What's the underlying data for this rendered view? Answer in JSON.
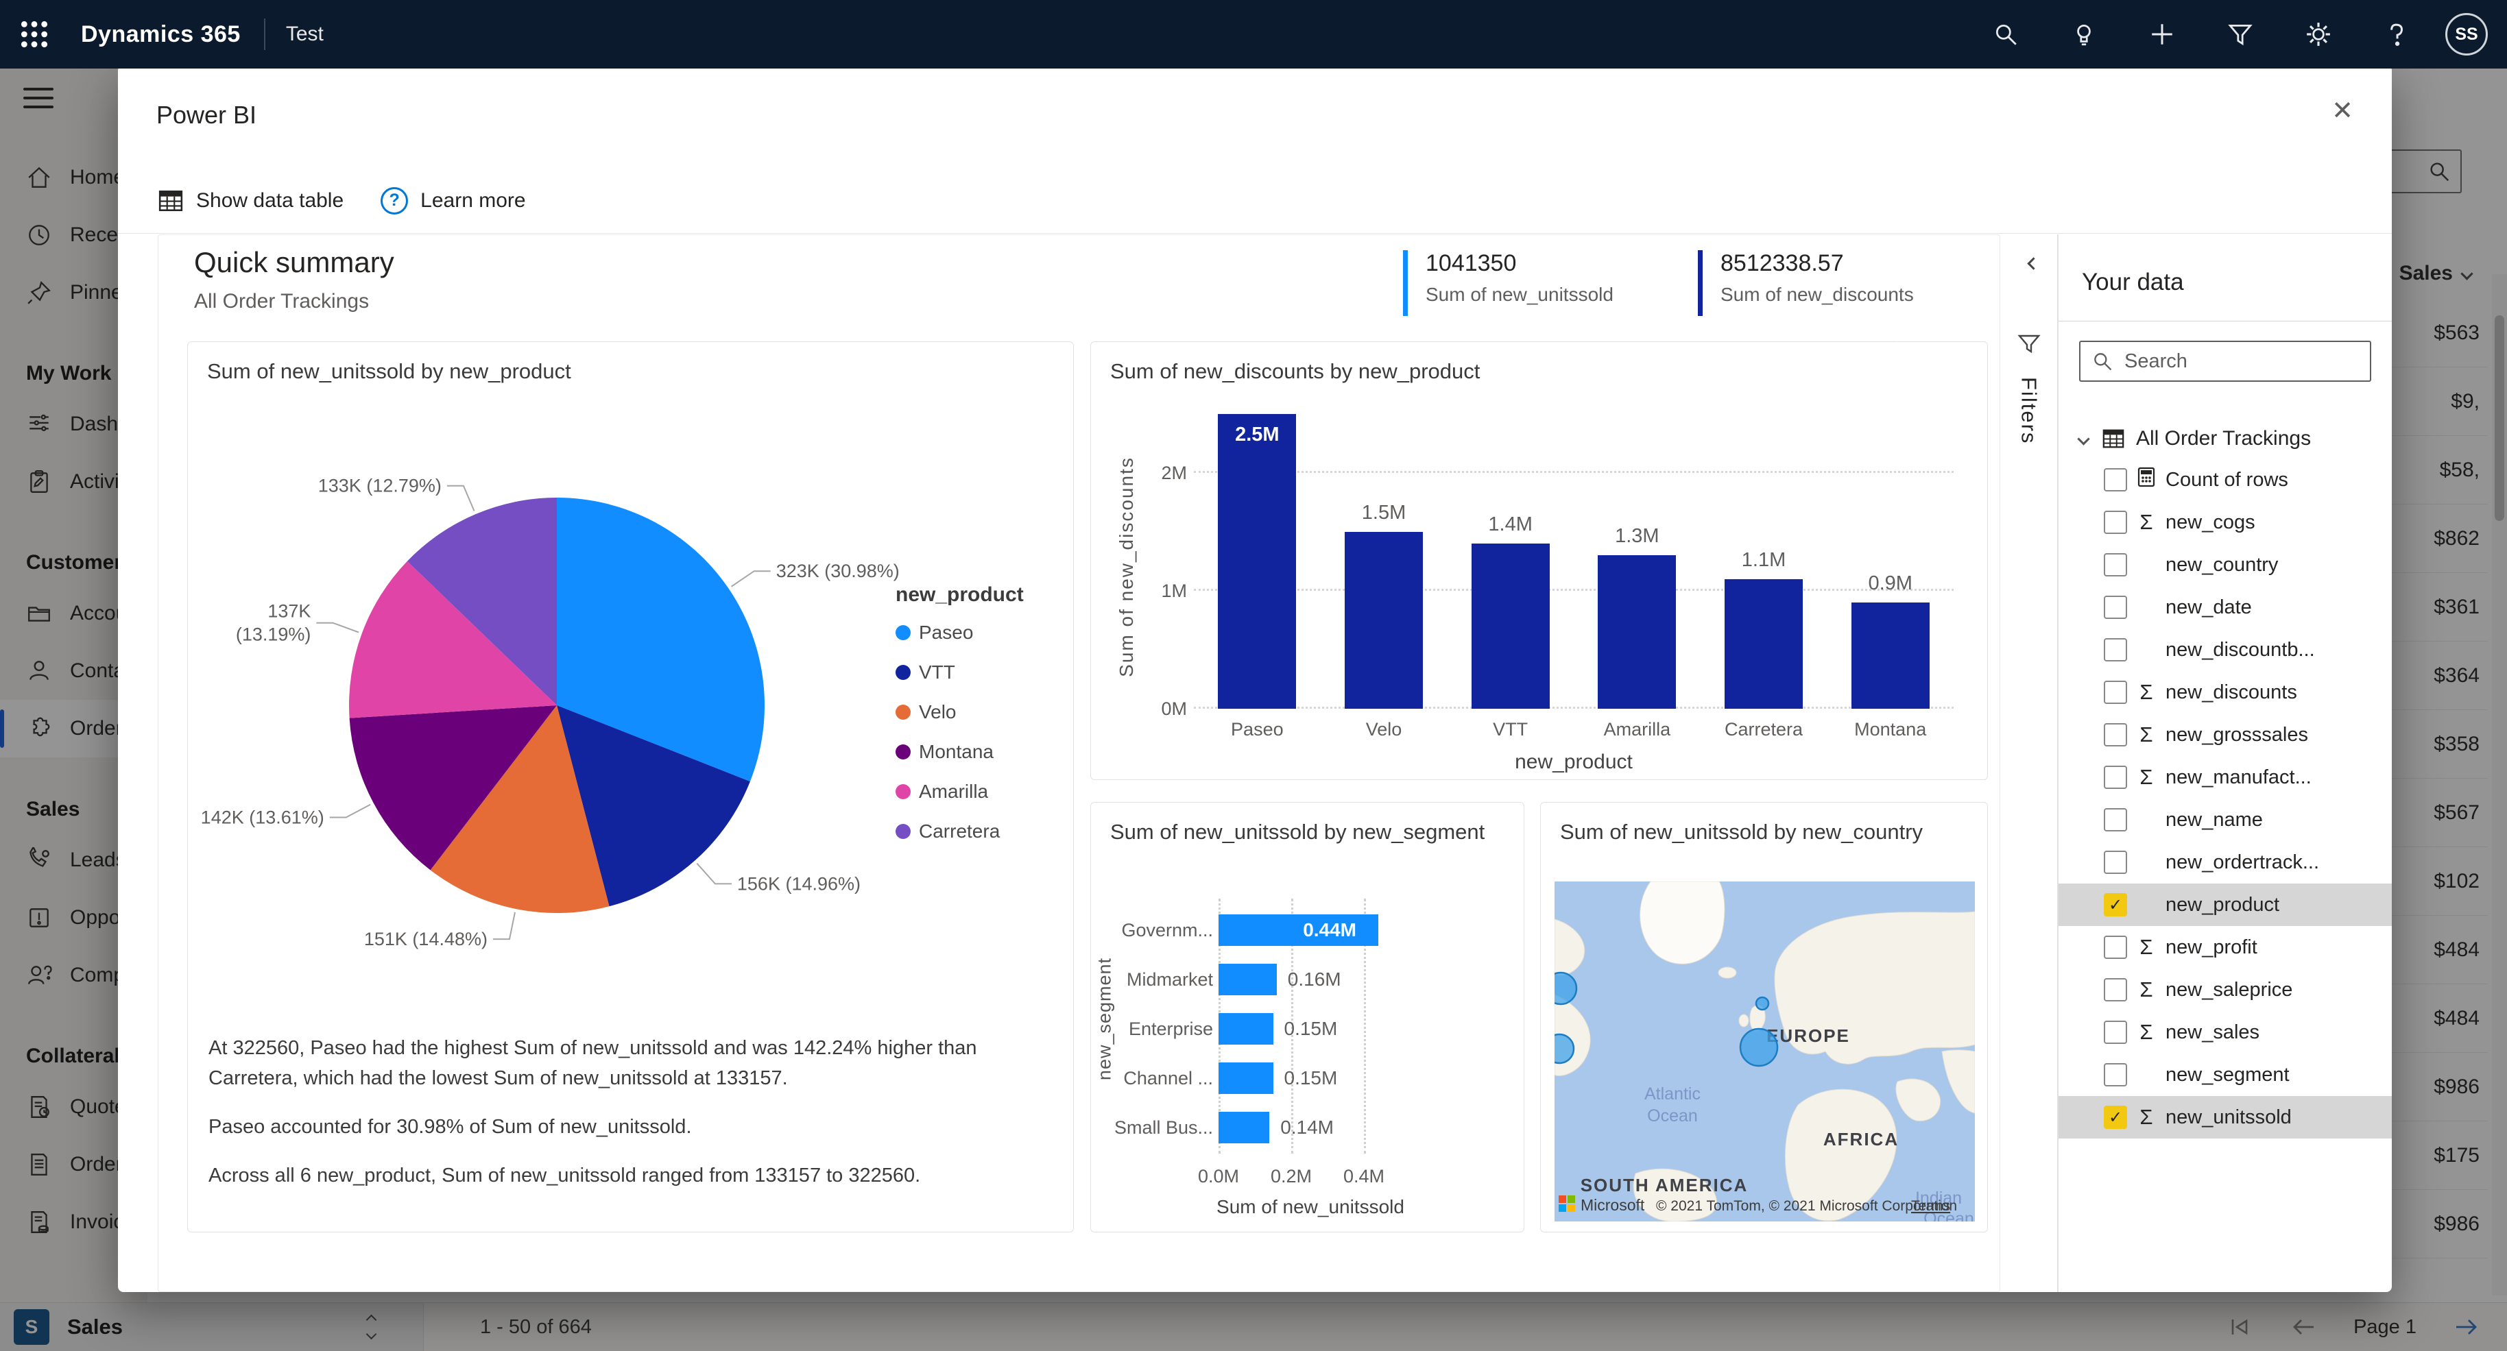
{
  "glyphs": {
    "close": "✕",
    "check": "✓",
    "sigma": "Σ",
    "ellipsis": "…",
    "pencil": "✎"
  },
  "colors": {
    "topbar": "#0b1a2c",
    "nav_selected_accent": "#2266E3",
    "checkbox_checked": "#F2C811",
    "metric1_accent": "#118DFF",
    "metric2_accent": "#12239E"
  },
  "topbar": {
    "app_title": "Dynamics 365",
    "environment": "Test",
    "avatar_initials": "SS"
  },
  "sidebar": {
    "entries": [
      {
        "type": "item",
        "icon": "home",
        "label": "Home"
      },
      {
        "type": "item",
        "icon": "clock",
        "label": "Recent"
      },
      {
        "type": "item",
        "icon": "pin",
        "label": "Pinned"
      },
      {
        "type": "header",
        "label": "My Work"
      },
      {
        "type": "item",
        "icon": "dashboard",
        "label": "Dashboards"
      },
      {
        "type": "item",
        "icon": "clipboard",
        "label": "Activities"
      },
      {
        "type": "header",
        "label": "Customers"
      },
      {
        "type": "item",
        "icon": "folder",
        "label": "Accounts"
      },
      {
        "type": "item",
        "icon": "person",
        "label": "Contacts"
      },
      {
        "type": "item",
        "icon": "puzzle",
        "label": "Orders",
        "selected": true
      },
      {
        "type": "header",
        "label": "Sales"
      },
      {
        "type": "item",
        "icon": "phone",
        "label": "Leads"
      },
      {
        "type": "item",
        "icon": "alert-box",
        "label": "Opportunities"
      },
      {
        "type": "item",
        "icon": "person-question",
        "label": "Competitors"
      },
      {
        "type": "header",
        "label": "Collateral"
      },
      {
        "type": "item",
        "icon": "doc-clock",
        "label": "Quotes"
      },
      {
        "type": "item",
        "icon": "doc",
        "label": "Orders"
      },
      {
        "type": "item",
        "icon": "doc-coins",
        "label": "Invoices"
      }
    ],
    "area_switcher": {
      "initial": "S",
      "label": "Sales"
    }
  },
  "background_grid": {
    "column_header": "Sales",
    "row_values": [
      "$563",
      "$9,",
      "$58,",
      "$862",
      "$361",
      "$364",
      "$358",
      "$567",
      "$102",
      "$484",
      "$484",
      "$986",
      "$175",
      "$986"
    ]
  },
  "bottombar": {
    "record_range": "1 - 50 of 664",
    "page_label": "Page 1"
  },
  "modal": {
    "title": "Power BI",
    "toolbar": {
      "show_data_table": "Show data table",
      "learn_more": "Learn more"
    },
    "summary": {
      "title": "Quick summary",
      "subtitle": "All Order Trackings",
      "metrics": [
        {
          "value": "1041350",
          "label": "Sum of new_unitssold",
          "accent": "#118DFF"
        },
        {
          "value": "8512338.57",
          "label": "Sum of new_discounts",
          "accent": "#12239E"
        }
      ]
    },
    "filters_rail": {
      "label": "Filters"
    },
    "insights": [
      "At 322560, Paseo had the highest Sum of new_unitssold and was 142.24% higher than Carretera, which had the lowest Sum of new_unitssold at 133157.",
      "Paseo accounted for 30.98% of Sum of new_unitssold.",
      "Across all 6 new_product, Sum of new_unitssold ranged from 133157 to 322560."
    ],
    "your_data": {
      "title": "Your data",
      "search_placeholder": "Search",
      "table_name": "All Order Trackings",
      "fields": [
        {
          "label": "Count of rows",
          "icon": "calculator",
          "checked": false
        },
        {
          "label": "new_cogs",
          "icon": "sigma",
          "checked": false
        },
        {
          "label": "new_country",
          "icon": "none",
          "checked": false
        },
        {
          "label": "new_date",
          "icon": "none",
          "checked": false
        },
        {
          "label": "new_discountb...",
          "icon": "none",
          "checked": false
        },
        {
          "label": "new_discounts",
          "icon": "sigma",
          "checked": false
        },
        {
          "label": "new_grosssales",
          "icon": "sigma",
          "checked": false
        },
        {
          "label": "new_manufact...",
          "icon": "sigma",
          "checked": false
        },
        {
          "label": "new_name",
          "icon": "none",
          "checked": false
        },
        {
          "label": "new_ordertrack...",
          "icon": "none",
          "checked": false
        },
        {
          "label": "new_product",
          "icon": "none",
          "checked": true,
          "selected": true
        },
        {
          "label": "new_profit",
          "icon": "sigma",
          "checked": false
        },
        {
          "label": "new_saleprice",
          "icon": "sigma",
          "checked": false
        },
        {
          "label": "new_sales",
          "icon": "sigma",
          "checked": false
        },
        {
          "label": "new_segment",
          "icon": "none",
          "checked": false
        },
        {
          "label": "new_unitssold",
          "icon": "sigma",
          "checked": true,
          "selected": true
        }
      ]
    }
  },
  "chart_data": [
    {
      "type": "pie",
      "title": "Sum of new_unitssold by new_product",
      "legend_title": "new_product",
      "legend_position": "right",
      "categories": [
        "Paseo",
        "VTT",
        "Velo",
        "Montana",
        "Amarilla",
        "Carretera"
      ],
      "values": [
        322560,
        155786,
        150787,
        141728,
        137354,
        133157
      ],
      "percents": [
        30.98,
        14.96,
        14.48,
        13.61,
        13.19,
        12.79
      ],
      "point_labels": [
        [
          "323K (30.98%)"
        ],
        [
          "156K (14.96%)"
        ],
        [
          "151K (14.48%)"
        ],
        [
          "142K (13.61%)"
        ],
        [
          "137K",
          "(13.19%)"
        ],
        [
          "133K (12.79%)"
        ]
      ],
      "colors": [
        "#118DFF",
        "#12239E",
        "#E66C37",
        "#6B007B",
        "#E044A7",
        "#744EC2"
      ]
    },
    {
      "type": "bar",
      "title": "Sum of new_discounts by new_product",
      "categories": [
        "Paseo",
        "Velo",
        "VTT",
        "Amarilla",
        "Carretera",
        "Montana"
      ],
      "values_millions": [
        2.5,
        1.5,
        1.4,
        1.3,
        1.1,
        0.9
      ],
      "bar_labels": [
        "2.5M",
        "1.5M",
        "1.4M",
        "1.3M",
        "1.1M",
        "0.9M"
      ],
      "xlabel": "new_product",
      "ylabel": "Sum of new_discounts",
      "yticks": [
        "0M",
        "1M",
        "2M"
      ],
      "ytick_values": [
        0,
        1,
        2
      ],
      "ymax_millions": 2.5,
      "grid": "dotted",
      "color": "#12239E"
    },
    {
      "type": "bar-horizontal",
      "title": "Sum of new_unitssold by new_segment",
      "categories": [
        "Governm...",
        "Midmarket",
        "Enterprise",
        "Channel ...",
        "Small Bus..."
      ],
      "values_millions": [
        0.44,
        0.16,
        0.15,
        0.15,
        0.14
      ],
      "bar_labels": [
        "0.44M",
        "0.16M",
        "0.15M",
        "0.15M",
        "0.14M"
      ],
      "xlabel": "Sum of new_unitssold",
      "ylabel": "new_segment",
      "xticks": [
        "0.0M",
        "0.2M",
        "0.4M"
      ],
      "xtick_values": [
        0,
        0.2,
        0.4
      ],
      "grid": "dotted",
      "color": "#118DFF"
    },
    {
      "type": "map",
      "title": "Sum of new_unitssold by new_country",
      "region_labels": [
        "EUROPE",
        "AFRICA",
        "SOUTH AMERICA"
      ],
      "ocean_label_1": [
        "Atlantic",
        "Ocean"
      ],
      "ocean_label_2": [
        "Indian",
        "Ocean"
      ],
      "brand": "Microsoft",
      "attribution": "© 2021 TomTom, © 2021 Microsoft Corporation",
      "terms_label": "Terms",
      "bubbles": [
        {
          "x": 9,
          "y": 156,
          "r": 23
        },
        {
          "x": 7,
          "y": 244,
          "r": 21
        },
        {
          "x": 303,
          "y": 178,
          "r": 9
        },
        {
          "x": 298,
          "y": 242,
          "r": 27
        }
      ]
    }
  ]
}
